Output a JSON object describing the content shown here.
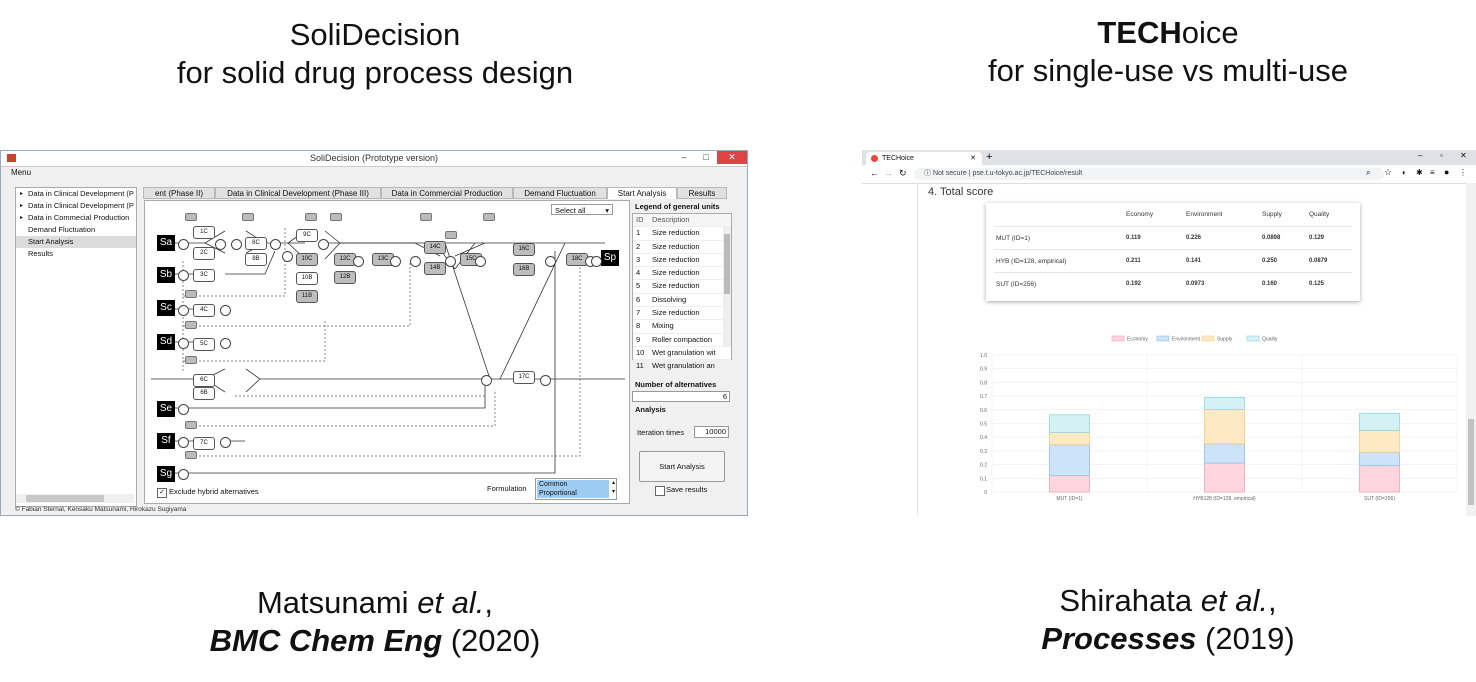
{
  "left_heading": {
    "line1": "SoliDecision",
    "line2": "for solid drug process design"
  },
  "right_heading": {
    "bold": "TECH",
    "rest": "oice",
    "line2": "for single-use vs multi-use"
  },
  "left_citation": {
    "authors": "Matsunami",
    "etal": "et al.",
    "comma": ",",
    "journal": "BMC Chem Eng",
    "year": " (2020)"
  },
  "right_citation": {
    "authors": "Shirahata",
    "etal": "et al.",
    "comma": ",",
    "journal": "Processes",
    "year": " (2019)"
  },
  "solidecision": {
    "window_title": "SoliDecision (Prototype version)",
    "menu": "Menu",
    "tree": [
      {
        "label": "Data in Clinical Development (P",
        "caret": true
      },
      {
        "label": "Data in Clinical Development (P",
        "caret": true
      },
      {
        "label": "Data in Commecial Production",
        "caret": true
      },
      {
        "label": "Demand Fluctuation",
        "caret": false
      },
      {
        "label": "Start Analysis",
        "caret": false,
        "selected": true
      },
      {
        "label": "Results",
        "caret": false
      }
    ],
    "tabs": [
      "ent (Phase II)",
      "Data in Clinical Development (Phase III)",
      "Data in Commercial Production",
      "Demand Fluctuation",
      "Start Analysis",
      "Results"
    ],
    "select_all": "Select all",
    "legend_title": "Legend of general units",
    "legend_headers": {
      "id": "ID",
      "desc": "Description"
    },
    "legend_rows": [
      {
        "id": "1",
        "desc": "Size reduction"
      },
      {
        "id": "2",
        "desc": "Size reduction"
      },
      {
        "id": "3",
        "desc": "Size reduction"
      },
      {
        "id": "4",
        "desc": "Size reduction"
      },
      {
        "id": "5",
        "desc": "Size reduction"
      },
      {
        "id": "6",
        "desc": "Dissolving"
      },
      {
        "id": "7",
        "desc": "Size reduction"
      },
      {
        "id": "8",
        "desc": "Mixing"
      },
      {
        "id": "9",
        "desc": "Roller compaction"
      },
      {
        "id": "10",
        "desc": "Wet granulation wit"
      },
      {
        "id": "11",
        "desc": "Wet granulation an"
      }
    ],
    "num_alt_label": "Number of alternatives",
    "num_alt_value": "6",
    "analysis_label": "Analysis",
    "iteration_label": "Iteration times",
    "iteration_value": "10000",
    "start_button": "Start Analysis",
    "save_results": "Save results",
    "exclude_hybrid": "Exclude hybrid alternatives",
    "formulation_label": "Formulation",
    "formulation_options": [
      "Common",
      "Proportional"
    ],
    "footer": "© Fabian Sternal, Kensaku Matsunami, Hirokazu Sugiyama",
    "sources": [
      "Sa",
      "Sb",
      "Sc",
      "Sd",
      "Se",
      "Sf",
      "Sg",
      "Sp"
    ],
    "units": [
      "1C",
      "2C",
      "3C",
      "4C",
      "5C",
      "6C",
      "6B",
      "7C",
      "8C",
      "8B",
      "9C",
      "10C",
      "10B",
      "11B",
      "12C",
      "12B",
      "13C",
      "14C",
      "14B",
      "15C",
      "16C",
      "16B",
      "17C",
      "18C"
    ]
  },
  "techoice": {
    "tab_title": "TECHoice",
    "url_prefix": "Not secure",
    "url": "pse.t.u-tokyo.ac.jp/TECHoice/result",
    "section_title": "4. Total score",
    "table_headers": [
      "Economy",
      "Environment",
      "Supply",
      "Quality"
    ],
    "table_rows": [
      {
        "name": "MUT (ID=1)",
        "values": [
          "0.119",
          "0.226",
          "0.0898",
          "0.129"
        ]
      },
      {
        "name": "HYB (ID=128, empirical)",
        "values": [
          "0.211",
          "0.141",
          "0.250",
          "0.0879"
        ]
      },
      {
        "name": "SUT (ID=256)",
        "values": [
          "0.192",
          "0.0973",
          "0.160",
          "0.125"
        ]
      }
    ],
    "colors": {
      "Economy": "#ffd6df",
      "Environment": "#cde3f7",
      "Supply": "#fde9c4",
      "Quality": "#d4f1f3"
    },
    "borders": {
      "Economy": "#f5a3b5",
      "Environment": "#8fbfe8",
      "Supply": "#f7cd82",
      "Quality": "#92d6dc"
    }
  },
  "chart_data": {
    "type": "bar",
    "stacked": true,
    "categories": [
      "MUT (ID=1)",
      "HYB128 (ID=128, empirical)",
      "SUT (ID=256)"
    ],
    "series": [
      {
        "name": "Economy",
        "values": [
          0.119,
          0.211,
          0.192
        ]
      },
      {
        "name": "Environment",
        "values": [
          0.226,
          0.141,
          0.0973
        ]
      },
      {
        "name": "Supply",
        "values": [
          0.0898,
          0.25,
          0.16
        ]
      },
      {
        "name": "Quality",
        "values": [
          0.129,
          0.0879,
          0.125
        ]
      }
    ],
    "ylim": [
      0,
      1.0
    ],
    "yticks": [
      "0",
      "0.1",
      "0.2",
      "0.3",
      "0.4",
      "0.5",
      "0.6",
      "0.7",
      "0.8",
      "0.9",
      "1.0"
    ],
    "legend": "top-center",
    "grid": true
  }
}
